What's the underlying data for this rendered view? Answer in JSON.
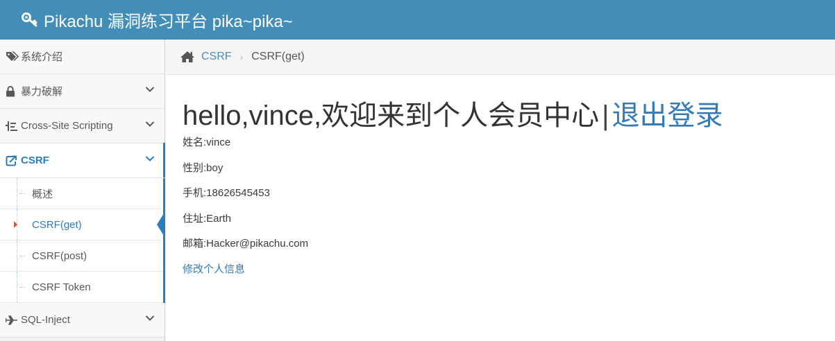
{
  "header": {
    "title": "Pikachu 漏洞练习平台 pika~pika~"
  },
  "sidebar": {
    "items": [
      {
        "label": "系统介绍",
        "icon": "tags-icon"
      },
      {
        "label": "暴力破解",
        "icon": "lock-icon"
      },
      {
        "label": "Cross-Site Scripting",
        "icon": "list-icon"
      },
      {
        "label": "CSRF",
        "icon": "share-icon"
      },
      {
        "label": "SQL-Inject",
        "icon": "plane-icon"
      }
    ],
    "csrf_submenu": [
      {
        "label": "概述"
      },
      {
        "label": "CSRF(get)"
      },
      {
        "label": "CSRF(post)"
      },
      {
        "label": "CSRF Token"
      }
    ]
  },
  "breadcrumb": {
    "parent": "CSRF",
    "separator": "›",
    "current": "CSRF(get)"
  },
  "main": {
    "greeting": "hello,vince,欢迎来到个人会员中心",
    "separator": "|",
    "logout": "退出登录",
    "fields": [
      "姓名:vince",
      "性别:boy",
      "手机:18626545453",
      "住址:Earth",
      "邮箱:Hacker@pikachu.com"
    ],
    "edit_link": "修改个人信息"
  },
  "colors": {
    "navbar": "#438eb9",
    "active_blue": "#2b7dbc",
    "link_blue": "#337ab7",
    "caret_red": "#c35b3b"
  }
}
